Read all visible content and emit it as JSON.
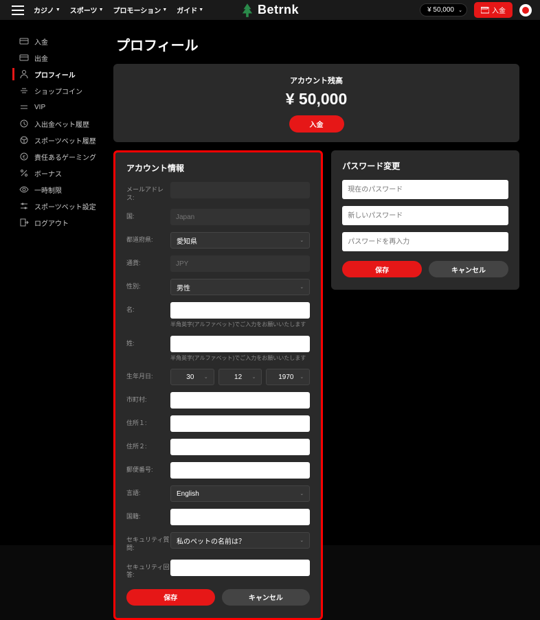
{
  "topnav": {
    "items": [
      "カジノ",
      "スポーツ",
      "プロモーション",
      "ガイド"
    ],
    "logo": "Betrnk",
    "balance_pill": "¥ 50,000",
    "deposit": "入金"
  },
  "sidebar": {
    "items": [
      {
        "label": "入金",
        "icon": "card"
      },
      {
        "label": "出金",
        "icon": "card"
      },
      {
        "label": "プロフィール",
        "icon": "user",
        "active": true
      },
      {
        "label": "ショップコイン",
        "icon": "coin"
      },
      {
        "label": "VIP",
        "icon": "vip"
      },
      {
        "label": "入出金ベット履歴",
        "icon": "history"
      },
      {
        "label": "スポーツベット履歴",
        "icon": "ball"
      },
      {
        "label": "責任あるゲーミング",
        "icon": "shield"
      },
      {
        "label": "ボーナス",
        "icon": "percent"
      },
      {
        "label": "一時制限",
        "icon": "eye"
      },
      {
        "label": "スポーツベット設定",
        "icon": "sliders"
      },
      {
        "label": "ログアウト",
        "icon": "logout"
      }
    ]
  },
  "page": {
    "title": "プロフィール"
  },
  "balance": {
    "label": "アカウント残高",
    "amount": "¥ 50,000",
    "deposit": "入金"
  },
  "account": {
    "title": "アカウント情報",
    "email_label": "メールアドレス:",
    "country_label": "国:",
    "country_value": "Japan",
    "pref_label": "都道府県:",
    "pref_value": "愛知県",
    "currency_label": "通貨:",
    "currency_value": "JPY",
    "gender_label": "性別:",
    "gender_value": "男性",
    "first_label": "名:",
    "last_label": "姓:",
    "name_help": "半角英字(アルファベット)でご入力をお願いいたします",
    "dob_label": "生年月日:",
    "dob_day": "30",
    "dob_month": "12",
    "dob_year": "1970",
    "city_label": "市町村:",
    "addr1_label": "住所１:",
    "addr2_label": "住所２:",
    "postal_label": "郵便番号:",
    "lang_label": "言語:",
    "lang_value": "English",
    "nat_label": "国籍:",
    "secq_label": "セキュリティ質問:",
    "secq_value": "私のペットの名前は？",
    "seca_label": "セキュリティ回答:",
    "save": "保存",
    "cancel": "キャンセル"
  },
  "password": {
    "title": "パスワード変更",
    "current": "現在のパスワード",
    "new": "新しいパスワード",
    "confirm": "パスワードを再入力",
    "save": "保存",
    "cancel": "キャンセル"
  }
}
